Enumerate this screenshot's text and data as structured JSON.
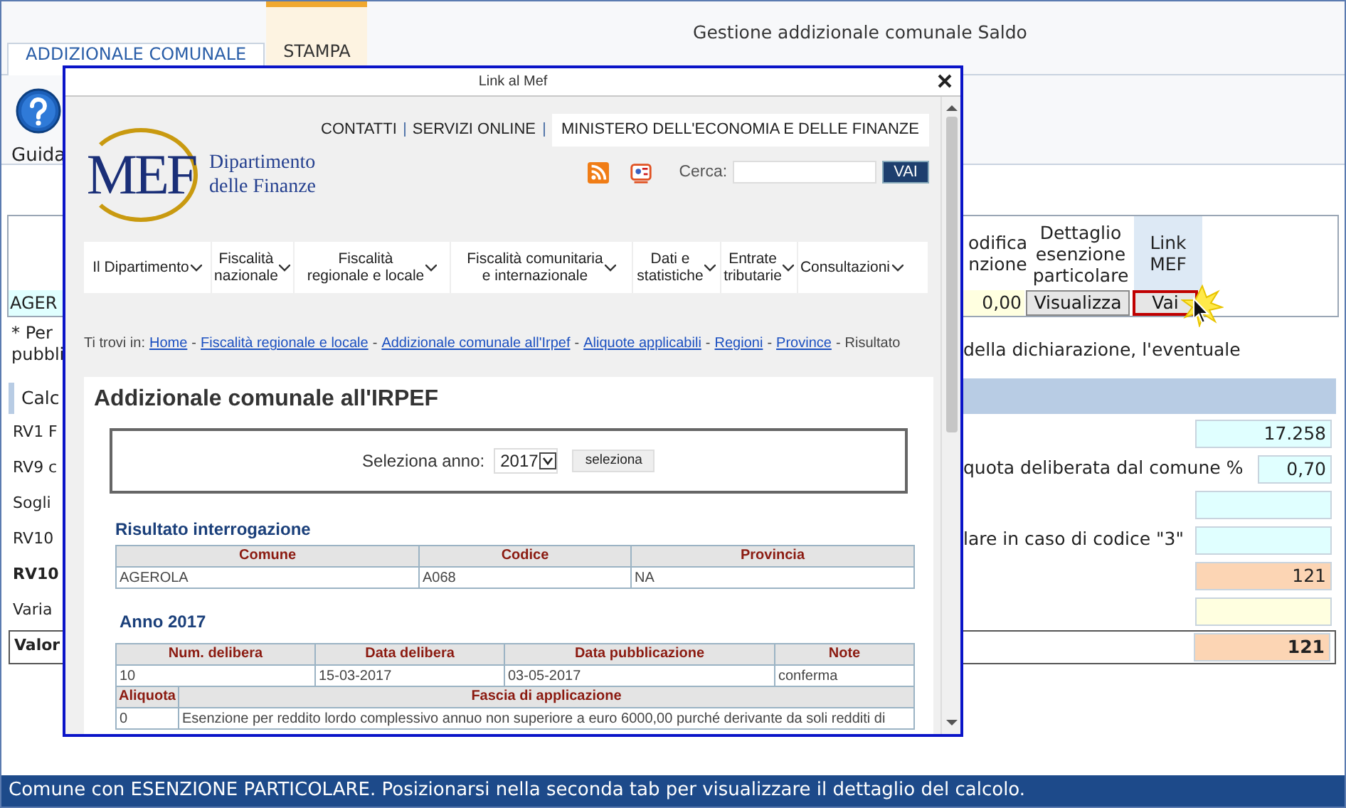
{
  "window": {
    "title": "Gestione addizionale comunale Saldo"
  },
  "tabs": [
    {
      "label": "ADDIZIONALE COMUNALE",
      "selected": true,
      "hovered": false
    },
    {
      "label": "STAMPA",
      "selected": false,
      "hovered": true
    }
  ],
  "toolbar": [
    {
      "label": "Guida"
    }
  ],
  "comune_table": {
    "left_cell": "AGER",
    "columns": [
      {
        "label": "odifica\nnzione",
        "highlighted": false
      },
      {
        "label": "Dettaglio\nesenzione\nparticolare",
        "highlighted": false
      },
      {
        "label": "Link\nMEF",
        "highlighted": true
      }
    ],
    "cells": [
      {
        "kind": "amount",
        "value": "0,00"
      },
      {
        "kind": "button",
        "label": "Visualizza",
        "focused": false
      },
      {
        "kind": "button",
        "label": "Vai",
        "focused": true
      }
    ]
  },
  "note": {
    "left_lines": [
      "* Per",
      "pubbli"
    ],
    "right": "della dichiarazione, l'eventuale"
  },
  "calc": {
    "tab": "Calc",
    "rows": [
      {
        "label": "RV1 F",
        "kind": "plain",
        "field": {
          "kind": "wide",
          "value": "17.258",
          "color": "#e0ffff"
        }
      },
      {
        "label": "RV9 c",
        "kind": "plain",
        "text": "quota deliberata dal comune %",
        "field": {
          "kind": "short",
          "value": "0,70",
          "color": "#e0ffff"
        }
      },
      {
        "label": "Sogli",
        "kind": "plain",
        "field": {
          "kind": "wide",
          "color": "#e0ffff"
        }
      },
      {
        "label": "RV10",
        "kind": "plain",
        "text": "lare in caso di codice \"3\"",
        "field": {
          "kind": "wide",
          "color": "#e0ffff"
        }
      },
      {
        "label": "RV10",
        "kind": "bold",
        "field": {
          "kind": "wide",
          "value": "121",
          "color": "#fcd5b4"
        }
      },
      {
        "label": "Varia",
        "kind": "plain",
        "field": {
          "kind": "wide",
          "color": "#ffffe0"
        }
      },
      {
        "label": "Valor",
        "kind": "total",
        "field": {
          "kind": "wide",
          "value": "121",
          "color": "#fcd5b4"
        }
      }
    ]
  },
  "dialog": {
    "title": "Link al Mef",
    "site": {
      "logo_text": "MEF",
      "logo_caption": [
        "Dipartimento",
        "delle Finanze"
      ],
      "top_links": [
        "CONTATTI",
        "SERVIZI ONLINE"
      ],
      "ministry": "MINISTERO DELL'ECONOMIA E DELLE FINANZE",
      "search_label": "Cerca:",
      "search_button": "VAI",
      "nav": [
        {
          "label": "Il Dipartimento"
        },
        {
          "label": "Fiscalità\nnazionale"
        },
        {
          "label": "Fiscalità\nregionale e locale"
        },
        {
          "label": "Fiscalità comunitaria\ne internazionale"
        },
        {
          "label": "Dati e\nstatistiche"
        },
        {
          "label": "Entrate\ntributarie"
        },
        {
          "label": "Consultazioni"
        }
      ],
      "breadcrumb_prefix": "Ti trovi in:",
      "breadcrumb_separator": "-",
      "breadcrumb": [
        {
          "label": "Home",
          "link": true
        },
        {
          "label": "Fiscalità regionale e locale",
          "link": true
        },
        {
          "label": "Addizionale comunale all'Irpef",
          "link": true
        },
        {
          "label": "Aliquote applicabili",
          "link": true
        },
        {
          "label": "Regioni",
          "link": true
        },
        {
          "label": "Province",
          "link": true
        },
        {
          "label": "Risultato",
          "link": false
        }
      ],
      "heading": "Addizionale comunale all'IRPEF",
      "year_label": "Seleziona anno:",
      "year": "2017",
      "select_button": "seleziona",
      "result_title": "Risultato interrogazione",
      "result_table": {
        "columns": [
          "Comune",
          "Codice",
          "Provincia"
        ],
        "rows": [
          [
            "AGEROLA",
            "A068",
            "NA"
          ]
        ]
      },
      "year_title": "Anno 2017",
      "delibera_table": {
        "columns": [
          "Num. delibera",
          "Data delibera",
          "Data pubblicazione",
          "Note"
        ],
        "rows": [
          [
            "10",
            "15-03-2017",
            "03-05-2017",
            "conferma"
          ]
        ]
      },
      "rate_table": {
        "columns": [
          "Aliquota",
          "Fascia di applicazione"
        ],
        "rows": [
          [
            "0",
            "Esenzione per reddito lordo complessivo annuo non superiore a euro 6000,00 purché derivante da soli redditi di"
          ]
        ]
      }
    }
  },
  "status_bar": "Comune con ESENZIONE PARTICOLARE. Posizionarsi nella seconda tab per visualizzare il dettaglio del calcolo."
}
